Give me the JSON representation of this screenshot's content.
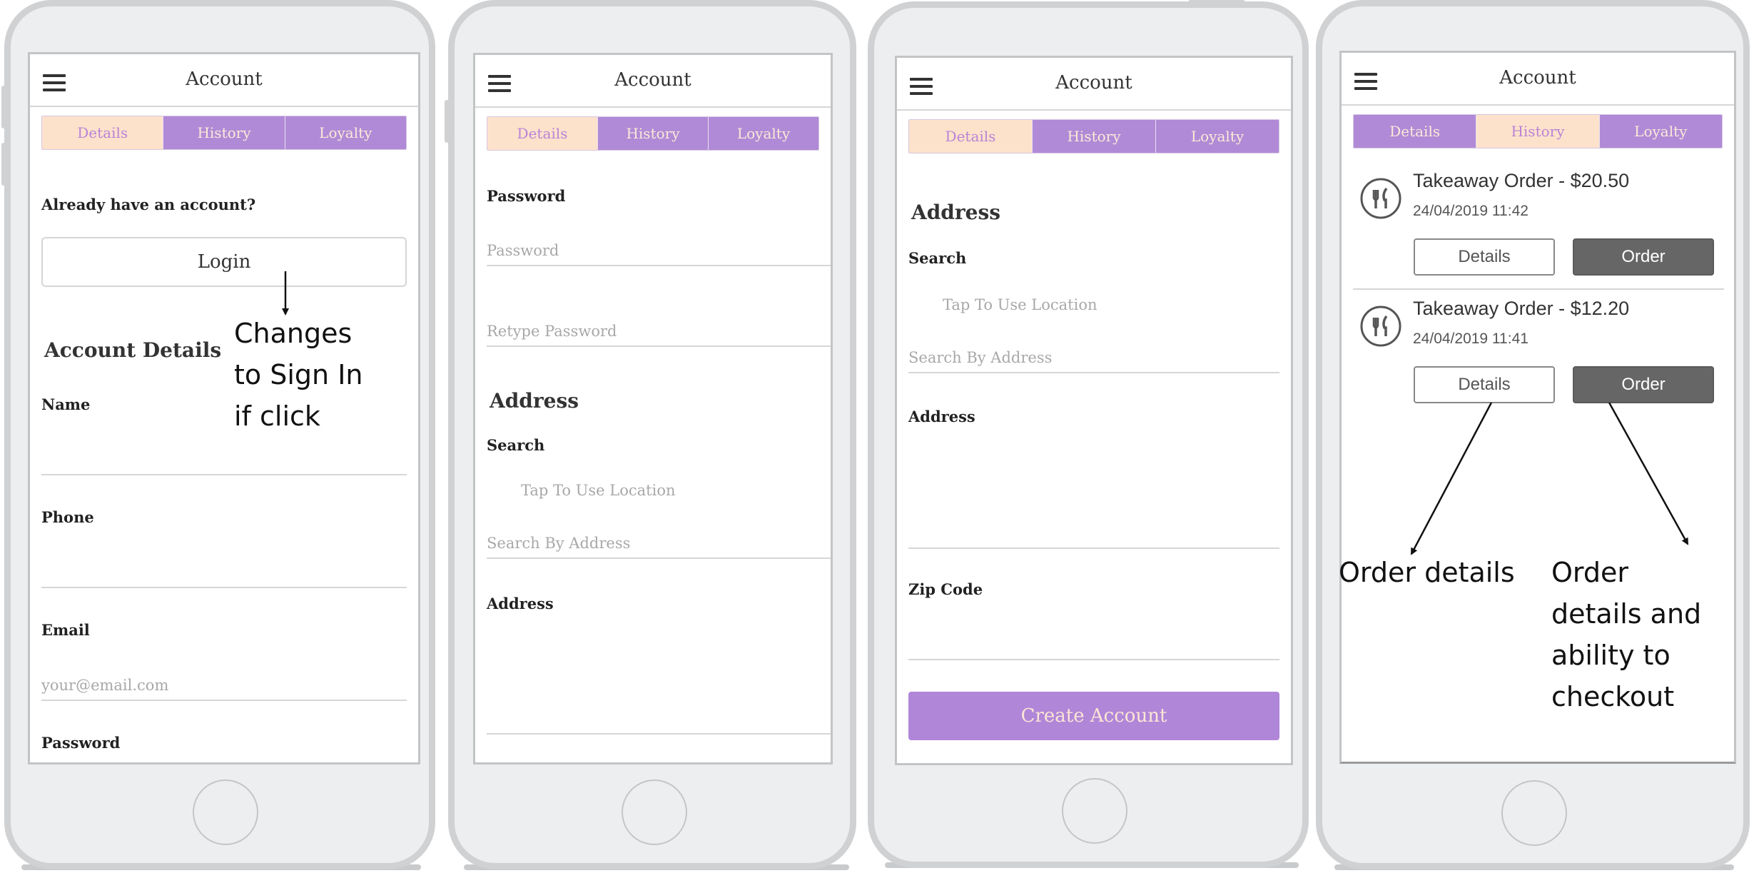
{
  "header": {
    "title": "Account"
  },
  "tabs": [
    {
      "label": "Details"
    },
    {
      "label": "History"
    },
    {
      "label": "Loyalty"
    }
  ],
  "screen1": {
    "already": "Already have an account?",
    "login_label": "Login",
    "account_details": "Account Details",
    "name_label": "Name",
    "phone_label": "Phone",
    "email_label": "Email",
    "email_placeholder": "your@email.com",
    "password_label": "Password"
  },
  "screen2": {
    "password_label": "Password",
    "password_placeholder": "Password",
    "retype_placeholder": "Retype Password",
    "address_heading": "Address",
    "search_label": "Search",
    "tap_location": "Tap To Use Location",
    "search_address_placeholder": "Search By Address",
    "address_label": "Address"
  },
  "screen3": {
    "address_heading": "Address",
    "search_label": "Search",
    "tap_location": "Tap To Use Location",
    "search_address_placeholder": "Search By Address",
    "address_label": "Address",
    "zip_label": "Zip Code",
    "create_label": "Create Account"
  },
  "screen4": {
    "orders": [
      {
        "title": "Takeaway Order - $20.50",
        "date": "24/04/2019 11:42",
        "details_label": "Details",
        "order_label": "Order"
      },
      {
        "title": "Takeaway Order - $12.20",
        "date": "24/04/2019 11:41",
        "details_label": "Details",
        "order_label": "Order"
      }
    ]
  },
  "annotations": {
    "login_note": "Changes\nto Sign In\nif click",
    "details_note": "Order details",
    "order_note": "Order\ndetails and\nability to\ncheckout"
  },
  "colors": {
    "accent": "#b08ad6",
    "active_tab_bg": "#fde2cb",
    "dark_button": "#666666"
  },
  "icons": {
    "menu": "hamburger-menu-icon",
    "order": "fork-knife-icon"
  }
}
